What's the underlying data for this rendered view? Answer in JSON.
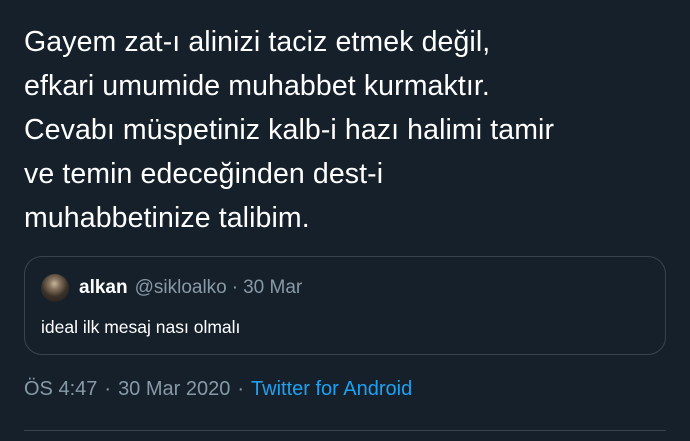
{
  "tweet": {
    "text": "Gayem zat-ı alinizi taciz etmek değil,\nefkari umumide muhabbet kurmaktır.\nCevabı müspetiniz kalb-i hazı halimi tamir\nve temin edeceğinden dest-i\nmuhabbetinize talibim."
  },
  "quote": {
    "name": "alkan",
    "handle": "@sikloalko",
    "separator": "·",
    "date": "30 Mar",
    "text": "ideal ilk mesaj nası olmalı"
  },
  "meta": {
    "time": "ÖS 4:47",
    "separator": "·",
    "date": "30 Mar 2020",
    "source": "Twitter for Android"
  },
  "colors": {
    "background": "#15202b",
    "text": "#ffffff",
    "secondary_text": "#8899a6",
    "link": "#1da1f2",
    "border": "#38444d"
  }
}
